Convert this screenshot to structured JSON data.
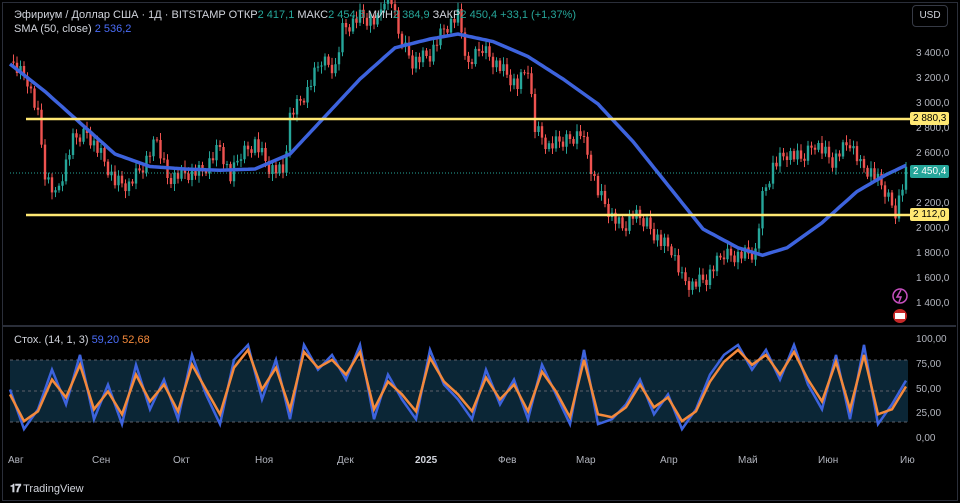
{
  "header": {
    "symbol": "Эфириум / Доллар США · 1Д · BITSTAMP",
    "open_label": "ОТКР",
    "open": "2 417,1",
    "high_label": "МАКС",
    "high": "2 454,6",
    "low_label": "МИН",
    "low": "2 384,9",
    "close_label": "ЗАКР",
    "close": "2 450,4",
    "change": "+33,1 (+1,37%)"
  },
  "sma_legend": {
    "label": "SMA (50, close)",
    "value": "2 536,2"
  },
  "stoch_legend": {
    "label": "Стох. (14, 1, 3)",
    "k": "59,20",
    "d": "52,68"
  },
  "currency_button": "USD",
  "levels": {
    "upper": "2 880,3",
    "lower": "2 112,0",
    "last": "2 450,4"
  },
  "price_axis": [
    "3 400,0",
    "3 200,0",
    "3 000,0",
    "2 800,0",
    "2 600,0",
    "2 200,0",
    "2 000,0",
    "1 800,0",
    "1 600,0",
    "1 400,0"
  ],
  "stoch_axis": [
    "100,00",
    "75,00",
    "50,00",
    "25,00",
    "0,00"
  ],
  "time_axis": [
    "Авг",
    "Сен",
    "Окт",
    "Ноя",
    "Дек",
    "2025",
    "Фев",
    "Мар",
    "Апр",
    "Май",
    "Июн",
    "Ию"
  ],
  "brand": "TradingView",
  "colors": {
    "up": "#26a69a",
    "down": "#ef5350",
    "sma": "#3d63dd",
    "level": "#ffe873",
    "k": "#3d63dd",
    "d": "#f4893b"
  },
  "chart_data": {
    "type": "candlestick",
    "ylim": [
      1300,
      3650
    ],
    "close_path": [
      [
        0,
        3340
      ],
      [
        5,
        3200
      ],
      [
        8,
        2900
      ],
      [
        10,
        2450
      ],
      [
        13,
        2250
      ],
      [
        18,
        2700
      ],
      [
        22,
        2780
      ],
      [
        26,
        2600
      ],
      [
        30,
        2380
      ],
      [
        34,
        2350
      ],
      [
        38,
        2500
      ],
      [
        42,
        2700
      ],
      [
        45,
        2420
      ],
      [
        50,
        2450
      ],
      [
        55,
        2460
      ],
      [
        60,
        2650
      ],
      [
        63,
        2400
      ],
      [
        66,
        2600
      ],
      [
        70,
        2700
      ],
      [
        74,
        2500
      ],
      [
        78,
        2450
      ],
      [
        80,
        2900
      ],
      [
        85,
        3100
      ],
      [
        89,
        3350
      ],
      [
        93,
        3300
      ],
      [
        95,
        3600
      ],
      [
        100,
        3700
      ],
      [
        105,
        3650
      ],
      [
        108,
        3950
      ],
      [
        111,
        3550
      ],
      [
        115,
        3350
      ],
      [
        120,
        3400
      ],
      [
        124,
        3600
      ],
      [
        128,
        3700
      ],
      [
        131,
        3300
      ],
      [
        135,
        3450
      ],
      [
        140,
        3300
      ],
      [
        145,
        3150
      ],
      [
        148,
        3300
      ],
      [
        150,
        2800
      ],
      [
        154,
        2650
      ],
      [
        158,
        2700
      ],
      [
        163,
        2780
      ],
      [
        165,
        2600
      ],
      [
        168,
        2300
      ],
      [
        172,
        2100
      ],
      [
        175,
        2000
      ],
      [
        178,
        2100
      ],
      [
        182,
        2050
      ],
      [
        186,
        1900
      ],
      [
        189,
        1850
      ],
      [
        192,
        1600
      ],
      [
        195,
        1550
      ],
      [
        199,
        1600
      ],
      [
        204,
        1800
      ],
      [
        209,
        1800
      ],
      [
        213,
        1820
      ],
      [
        215,
        2250
      ],
      [
        218,
        2500
      ],
      [
        222,
        2600
      ],
      [
        226,
        2550
      ],
      [
        230,
        2700
      ],
      [
        235,
        2550
      ],
      [
        240,
        2700
      ],
      [
        243,
        2500
      ],
      [
        246,
        2450
      ],
      [
        250,
        2300
      ],
      [
        253,
        2150
      ],
      [
        256,
        2450
      ]
    ],
    "sma50": [
      [
        0,
        3320
      ],
      [
        10,
        3100
      ],
      [
        22,
        2800
      ],
      [
        30,
        2600
      ],
      [
        40,
        2500
      ],
      [
        50,
        2480
      ],
      [
        60,
        2470
      ],
      [
        70,
        2480
      ],
      [
        80,
        2600
      ],
      [
        90,
        2900
      ],
      [
        100,
        3200
      ],
      [
        110,
        3450
      ],
      [
        120,
        3520
      ],
      [
        128,
        3560
      ],
      [
        138,
        3500
      ],
      [
        148,
        3380
      ],
      [
        158,
        3200
      ],
      [
        168,
        3000
      ],
      [
        178,
        2700
      ],
      [
        188,
        2350
      ],
      [
        198,
        2000
      ],
      [
        208,
        1850
      ],
      [
        215,
        1790
      ],
      [
        222,
        1850
      ],
      [
        232,
        2050
      ],
      [
        242,
        2300
      ],
      [
        250,
        2430
      ],
      [
        256,
        2510
      ]
    ],
    "stoch_k": [
      [
        0,
        50
      ],
      [
        4,
        10
      ],
      [
        8,
        30
      ],
      [
        12,
        70
      ],
      [
        16,
        35
      ],
      [
        20,
        85
      ],
      [
        24,
        20
      ],
      [
        28,
        55
      ],
      [
        32,
        15
      ],
      [
        36,
        75
      ],
      [
        40,
        30
      ],
      [
        44,
        60
      ],
      [
        48,
        20
      ],
      [
        52,
        85
      ],
      [
        56,
        45
      ],
      [
        60,
        15
      ],
      [
        64,
        80
      ],
      [
        68,
        95
      ],
      [
        72,
        40
      ],
      [
        76,
        80
      ],
      [
        80,
        20
      ],
      [
        84,
        95
      ],
      [
        88,
        70
      ],
      [
        92,
        85
      ],
      [
        96,
        60
      ],
      [
        100,
        95
      ],
      [
        104,
        20
      ],
      [
        108,
        65
      ],
      [
        112,
        40
      ],
      [
        116,
        20
      ],
      [
        120,
        90
      ],
      [
        124,
        55
      ],
      [
        128,
        40
      ],
      [
        132,
        20
      ],
      [
        136,
        70
      ],
      [
        140,
        35
      ],
      [
        144,
        60
      ],
      [
        148,
        20
      ],
      [
        152,
        75
      ],
      [
        156,
        45
      ],
      [
        160,
        15
      ],
      [
        164,
        90
      ],
      [
        168,
        15
      ],
      [
        172,
        20
      ],
      [
        176,
        35
      ],
      [
        180,
        60
      ],
      [
        184,
        25
      ],
      [
        188,
        45
      ],
      [
        192,
        10
      ],
      [
        196,
        30
      ],
      [
        200,
        65
      ],
      [
        204,
        85
      ],
      [
        208,
        95
      ],
      [
        212,
        70
      ],
      [
        216,
        90
      ],
      [
        220,
        60
      ],
      [
        224,
        95
      ],
      [
        228,
        55
      ],
      [
        232,
        30
      ],
      [
        236,
        85
      ],
      [
        240,
        20
      ],
      [
        244,
        95
      ],
      [
        248,
        15
      ],
      [
        252,
        35
      ],
      [
        256,
        59
      ]
    ],
    "stoch_d": [
      [
        0,
        45
      ],
      [
        4,
        18
      ],
      [
        8,
        28
      ],
      [
        12,
        60
      ],
      [
        16,
        42
      ],
      [
        20,
        75
      ],
      [
        24,
        30
      ],
      [
        28,
        48
      ],
      [
        32,
        25
      ],
      [
        36,
        65
      ],
      [
        40,
        38
      ],
      [
        44,
        55
      ],
      [
        48,
        28
      ],
      [
        52,
        75
      ],
      [
        56,
        50
      ],
      [
        60,
        25
      ],
      [
        64,
        72
      ],
      [
        68,
        90
      ],
      [
        72,
        50
      ],
      [
        76,
        72
      ],
      [
        80,
        30
      ],
      [
        84,
        88
      ],
      [
        88,
        72
      ],
      [
        92,
        80
      ],
      [
        96,
        65
      ],
      [
        100,
        88
      ],
      [
        104,
        30
      ],
      [
        108,
        58
      ],
      [
        112,
        45
      ],
      [
        116,
        28
      ],
      [
        120,
        82
      ],
      [
        124,
        58
      ],
      [
        128,
        45
      ],
      [
        132,
        28
      ],
      [
        136,
        62
      ],
      [
        140,
        40
      ],
      [
        144,
        55
      ],
      [
        148,
        28
      ],
      [
        152,
        68
      ],
      [
        156,
        48
      ],
      [
        160,
        22
      ],
      [
        164,
        80
      ],
      [
        168,
        25
      ],
      [
        172,
        22
      ],
      [
        176,
        32
      ],
      [
        180,
        55
      ],
      [
        184,
        32
      ],
      [
        188,
        42
      ],
      [
        192,
        18
      ],
      [
        196,
        28
      ],
      [
        200,
        58
      ],
      [
        204,
        78
      ],
      [
        208,
        90
      ],
      [
        212,
        75
      ],
      [
        216,
        85
      ],
      [
        220,
        65
      ],
      [
        224,
        88
      ],
      [
        228,
        60
      ],
      [
        232,
        38
      ],
      [
        236,
        78
      ],
      [
        240,
        30
      ],
      [
        244,
        85
      ],
      [
        248,
        25
      ],
      [
        252,
        30
      ],
      [
        256,
        53
      ]
    ]
  }
}
